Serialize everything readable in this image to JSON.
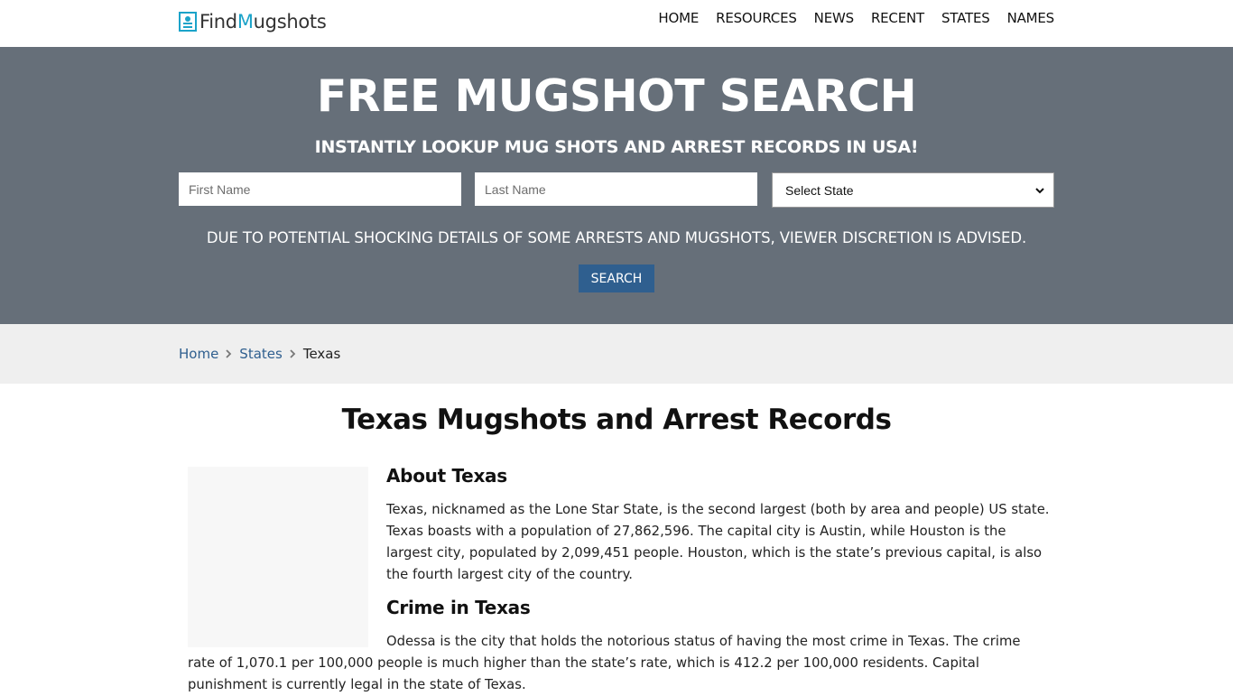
{
  "logo": {
    "part1": "Find",
    "part2": "M",
    "part3": "ugshots"
  },
  "nav": [
    "HOME",
    "RESOURCES",
    "NEWS",
    "RECENT",
    "STATES",
    "NAMES"
  ],
  "hero": {
    "title": "FREE MUGSHOT SEARCH",
    "subtitle": "INSTANTLY LOOKUP MUG SHOTS AND ARREST RECORDS IN USA!",
    "first_name_placeholder": "First Name",
    "last_name_placeholder": "Last Name",
    "state_select_value": "Select State",
    "disclaimer": "DUE TO POTENTIAL SHOCKING DETAILS OF SOME ARRESTS AND MUGSHOTS, VIEWER DISCRETION IS ADVISED.",
    "search_label": "SEARCH"
  },
  "breadcrumb": {
    "home": "Home",
    "states": "States",
    "current": "Texas"
  },
  "main": {
    "title": "Texas Mugshots and Arrest Records",
    "about_heading": "About Texas",
    "about_text": "Texas, nicknamed as the Lone Star State, is the second largest (both by area and people) US state. Texas boasts with a population of 27,862,596. The capital city is Austin, while Houston is the largest city, populated by 2,099,451 people. Houston, which is the state’s previous capital, is also the fourth largest city of the country.",
    "crime_heading": "Crime in Texas",
    "crime_text": "Odessa is the city that holds the notorious status of having the most crime in Texas. The crime rate of 1,070.1 per 100,000 people is much higher than the state’s rate, which is 412.2 per 100,000 residents. Capital punishment is currently legal in the state of Texas."
  },
  "colors": {
    "hero_bg": "#666f79",
    "button_bg": "#2f5f8f",
    "link": "#2f5f8f",
    "logo_accent": "#1ba3c9"
  },
  "icons": {
    "logo": "id-card-icon",
    "breadcrumb_separator": "chevron-right-icon",
    "select": "chevron-down-icon"
  }
}
